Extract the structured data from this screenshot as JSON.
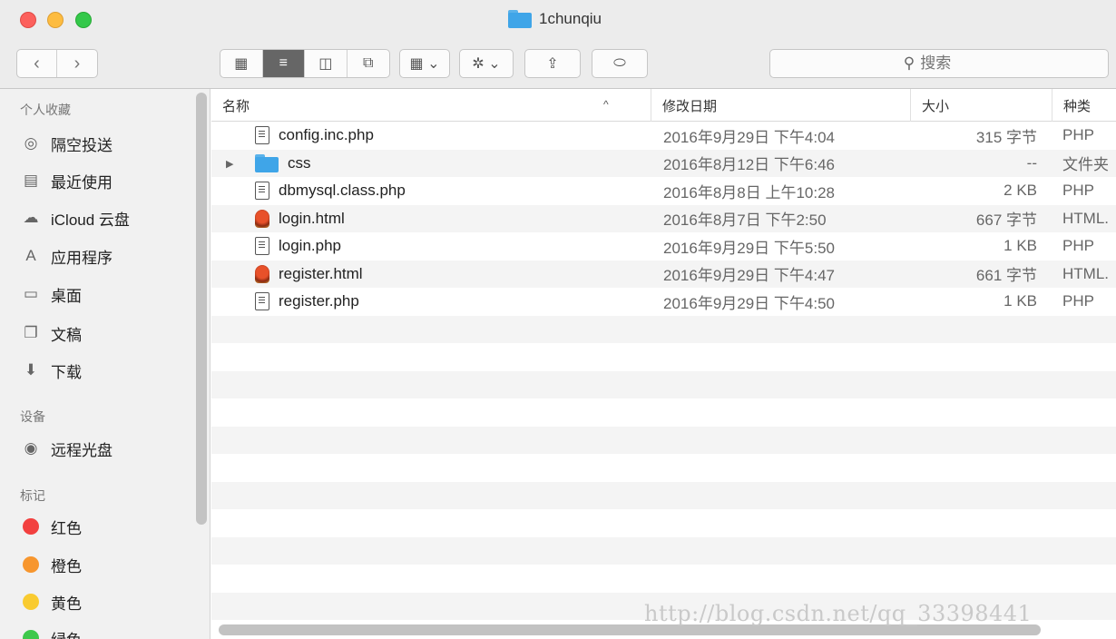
{
  "window": {
    "title": "1chunqiu"
  },
  "toolbar": {
    "back_icon": "‹",
    "forward_icon": "›",
    "view_icon_grid": "▦",
    "view_icon_list": "≡",
    "view_icon_columns": "◫",
    "view_icon_cover": "⧉",
    "arrange_icon": "▦ ⌄",
    "action_icon": "✲ ⌄",
    "share_icon": "⇪",
    "tag_icon": "⬭"
  },
  "search": {
    "placeholder": "搜索",
    "icon": "⚲"
  },
  "sidebar": {
    "favorites_header": "个人收藏",
    "favorites": [
      {
        "label": "隔空投送",
        "icon": "◎"
      },
      {
        "label": "最近使用",
        "icon": "▤"
      },
      {
        "label": "iCloud 云盘",
        "icon": "☁"
      },
      {
        "label": "应用程序",
        "icon": "A"
      },
      {
        "label": "桌面",
        "icon": "▭"
      },
      {
        "label": "文稿",
        "icon": "❐"
      },
      {
        "label": "下载",
        "icon": "⬇"
      }
    ],
    "devices_header": "设备",
    "devices": [
      {
        "label": "远程光盘",
        "icon": "◉"
      }
    ],
    "tags_header": "标记",
    "tags": [
      {
        "label": "红色",
        "color": "#f2403f"
      },
      {
        "label": "橙色",
        "color": "#f7962e"
      },
      {
        "label": "黄色",
        "color": "#f9cb30"
      },
      {
        "label": "绿色",
        "color": "#3ec84b"
      }
    ]
  },
  "columns": {
    "name": "名称",
    "date": "修改日期",
    "size": "大小",
    "kind": "种类",
    "sort_arrow": "^"
  },
  "files": [
    {
      "name": "config.inc.php",
      "date": "2016年9月29日 下午4:04",
      "size": "315 字节",
      "kind": "PHP",
      "icon": "doc-icon"
    },
    {
      "name": "css",
      "date": "2016年8月12日 下午6:46",
      "size": "--",
      "kind": "文件夹",
      "icon": "folder-icon",
      "disclosure": "▶"
    },
    {
      "name": "dbmysql.class.php",
      "date": "2016年8月8日 上午10:28",
      "size": "2 KB",
      "kind": "PHP",
      "icon": "doc-icon"
    },
    {
      "name": "login.html",
      "date": "2016年8月7日 下午2:50",
      "size": "667 字节",
      "kind": "HTML.",
      "icon": "html-icon"
    },
    {
      "name": "login.php",
      "date": "2016年9月29日 下午5:50",
      "size": "1 KB",
      "kind": "PHP",
      "icon": "doc-icon"
    },
    {
      "name": "register.html",
      "date": "2016年9月29日 下午4:47",
      "size": "661 字节",
      "kind": "HTML.",
      "icon": "html-icon"
    },
    {
      "name": "register.php",
      "date": "2016年9月29日 下午4:50",
      "size": "1 KB",
      "kind": "PHP",
      "icon": "doc-icon"
    }
  ],
  "watermark": "http://blog.csdn.net/qq_33398441"
}
